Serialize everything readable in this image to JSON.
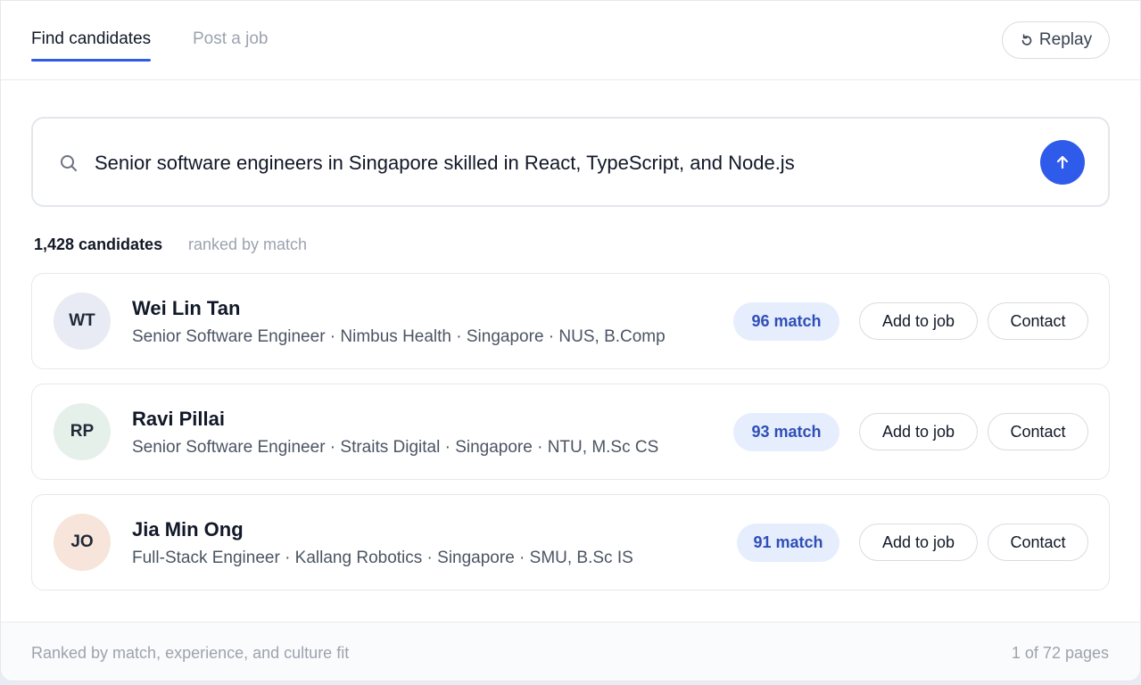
{
  "tabs": {
    "find_candidates": "Find candidates",
    "post_job": "Post a job"
  },
  "replay_label": "Replay",
  "search": {
    "query": "Senior software engineers in Singapore skilled in React, TypeScript, and Node.js"
  },
  "results": {
    "count": "1,428 candidates",
    "ranked_note": "ranked by match"
  },
  "candidates": [
    {
      "initials": "WT",
      "name": "Wei Lin Tan",
      "meta": "Senior Software Engineer · Nimbus Health · Singapore · NUS, B.Comp",
      "match": "96 match",
      "add_label": "Add to job",
      "contact_label": "Contact",
      "avatar_color": "#e8ebf3"
    },
    {
      "initials": "RP",
      "name": "Ravi Pillai",
      "meta": "Senior Software Engineer · Straits Digital · Singapore · NTU, M.Sc CS",
      "match": "93 match",
      "add_label": "Add to job",
      "contact_label": "Contact",
      "avatar_color": "#e6f0ea"
    },
    {
      "initials": "JO",
      "name": "Jia Min Ong",
      "meta": "Full-Stack Engineer · Kallang Robotics · Singapore · SMU, B.Sc IS",
      "match": "91 match",
      "add_label": "Add to job",
      "contact_label": "Contact",
      "avatar_color": "#f7e4da"
    }
  ],
  "footer": {
    "note": "Ranked by match, experience, and culture fit",
    "pagination": "1 of 72 pages"
  },
  "colors": {
    "accent": "#2f5bea",
    "match_bg": "#e6edfd",
    "match_text": "#2f4fb8"
  },
  "icons": {
    "replay": "replay-icon",
    "search": "search-icon",
    "submit": "arrow-up-icon"
  }
}
